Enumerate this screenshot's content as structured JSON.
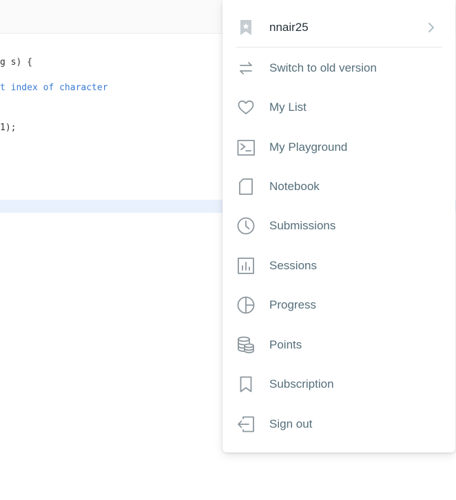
{
  "editor": {
    "lines": [
      {
        "text": "g s) {"
      },
      {
        "text": "t index of character"
      },
      {
        "text": "1);"
      }
    ]
  },
  "menu": {
    "header": {
      "username": "nnair25",
      "icon": "bookmark-star-icon"
    },
    "items": [
      {
        "label": "Switch to old version",
        "icon": "switch-arrows-icon"
      },
      {
        "label": "My List",
        "icon": "heart-icon"
      },
      {
        "label": "My Playground",
        "icon": "terminal-icon"
      },
      {
        "label": "Notebook",
        "icon": "notebook-icon"
      },
      {
        "label": "Submissions",
        "icon": "clock-icon"
      },
      {
        "label": "Sessions",
        "icon": "bar-chart-icon"
      },
      {
        "label": "Progress",
        "icon": "pie-chart-icon"
      },
      {
        "label": "Points",
        "icon": "coins-stack-icon"
      },
      {
        "label": "Subscription",
        "icon": "bookmark-icon"
      },
      {
        "label": "Sign out",
        "icon": "sign-out-icon"
      }
    ]
  },
  "colors": {
    "icon": "#8c979e",
    "label": "#546e7a",
    "username": "#263238",
    "code_comment": "#3a7bd5",
    "line_highlight": "#e8f1fc"
  }
}
